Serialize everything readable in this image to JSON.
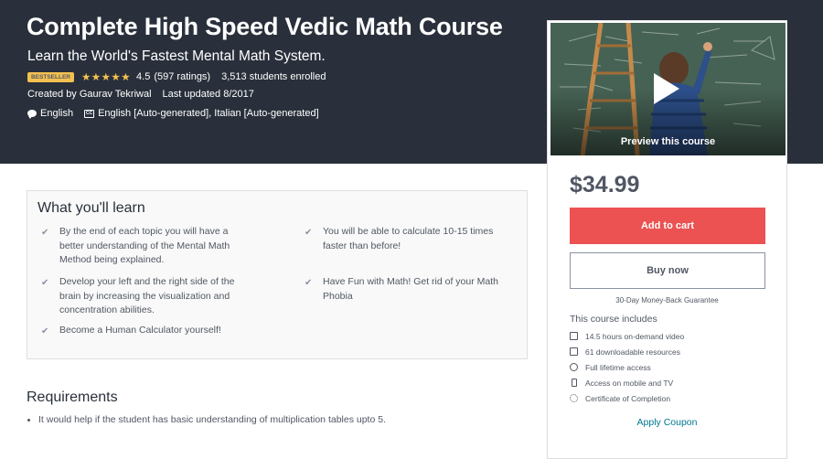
{
  "course": {
    "title": "Complete High Speed Vedic Math Course",
    "subtitle": "Learn the World's Fastest Mental Math System.",
    "badge": "BESTSELLER",
    "stars": "★★★★★",
    "rating": "4.5",
    "ratings_count": "(597 ratings)",
    "enrolled": "3,513 students enrolled",
    "created_by": "Created by Gaurav Tekriwal",
    "last_updated": "Last updated 8/2017",
    "language": "English",
    "captions": "English [Auto-generated], Italian [Auto-generated]"
  },
  "sidebar": {
    "preview_label": "Preview this course",
    "price": "$34.99",
    "add_to_cart": "Add to cart",
    "buy_now": "Buy now",
    "guarantee": "30-Day Money-Back Guarantee",
    "includes_title": "This course includes",
    "includes": [
      {
        "icon": "video-icon",
        "label": "14.5 hours on-demand video"
      },
      {
        "icon": "file-icon",
        "label": "61 downloadable resources"
      },
      {
        "icon": "infinity-icon",
        "label": "Full lifetime access"
      },
      {
        "icon": "mobile-icon",
        "label": "Access on mobile and TV"
      },
      {
        "icon": "certificate-icon",
        "label": "Certificate of Completion"
      }
    ],
    "coupon": "Apply Coupon"
  },
  "learn": {
    "title": "What you'll learn",
    "items": [
      "By the end of each topic you will have a better understanding of the Mental Math Method being explained.",
      "You will be able to calculate 10-15 times faster than before!",
      "Develop your left and the right side of the brain by increasing the visualization and concentration abilities.",
      "Have Fun with Math! Get rid of your Math Phobia",
      "Become a Human Calculator yourself!"
    ]
  },
  "requirements": {
    "title": "Requirements",
    "items": [
      "It would help if the student has basic understanding of multiplication tables upto 5."
    ]
  },
  "colors": {
    "hero_bg": "#29303b",
    "accent_red": "#ec5252",
    "star_gold": "#f4c150",
    "link_teal": "#007791"
  }
}
